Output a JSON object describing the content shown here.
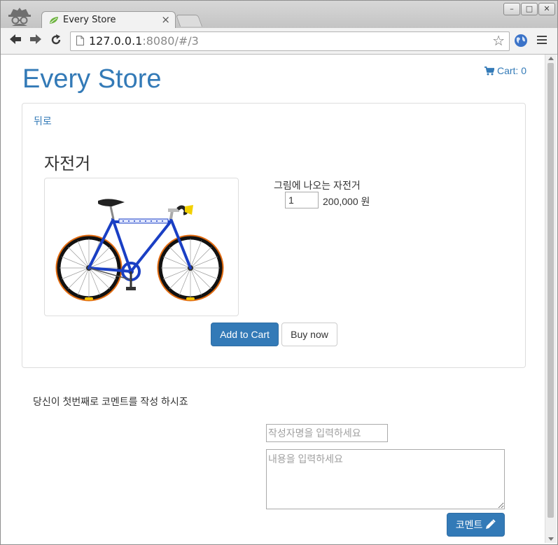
{
  "browser": {
    "tab_title": "Every Store",
    "tab_close": "×",
    "url_host": "127.0.0.1",
    "url_rest": ":8080/#/3",
    "window_buttons": [
      "–",
      "□",
      "✕"
    ]
  },
  "page": {
    "brand": "Every Store",
    "cart_label": "Cart: 0",
    "back_link": "뒤로",
    "product": {
      "name": "자전거",
      "description": "그림에 나오는 자전거",
      "quantity": "1",
      "price": "200,000 원"
    },
    "buttons": {
      "add_to_cart": "Add to Cart",
      "buy_now": "Buy now",
      "submit_comment": "코멘트"
    },
    "comments": {
      "empty_message": "당신이 첫번째로 코멘트를 작성 하시죠",
      "author_placeholder": "작성자명을 입력하세요",
      "content_placeholder": "내용을 입력하세요"
    }
  },
  "colors": {
    "link": "#337ab7",
    "primary_button": "#337ab7",
    "bike_frame": "#1a3fc4",
    "tire_accent": "#e06a10"
  },
  "icons": [
    "incognito-icon",
    "leaf-favicon-icon",
    "back-arrow-icon",
    "forward-arrow-icon",
    "reload-icon",
    "page-icon",
    "star-icon",
    "globe-icon",
    "menu-icon",
    "cart-icon",
    "pencil-icon"
  ]
}
